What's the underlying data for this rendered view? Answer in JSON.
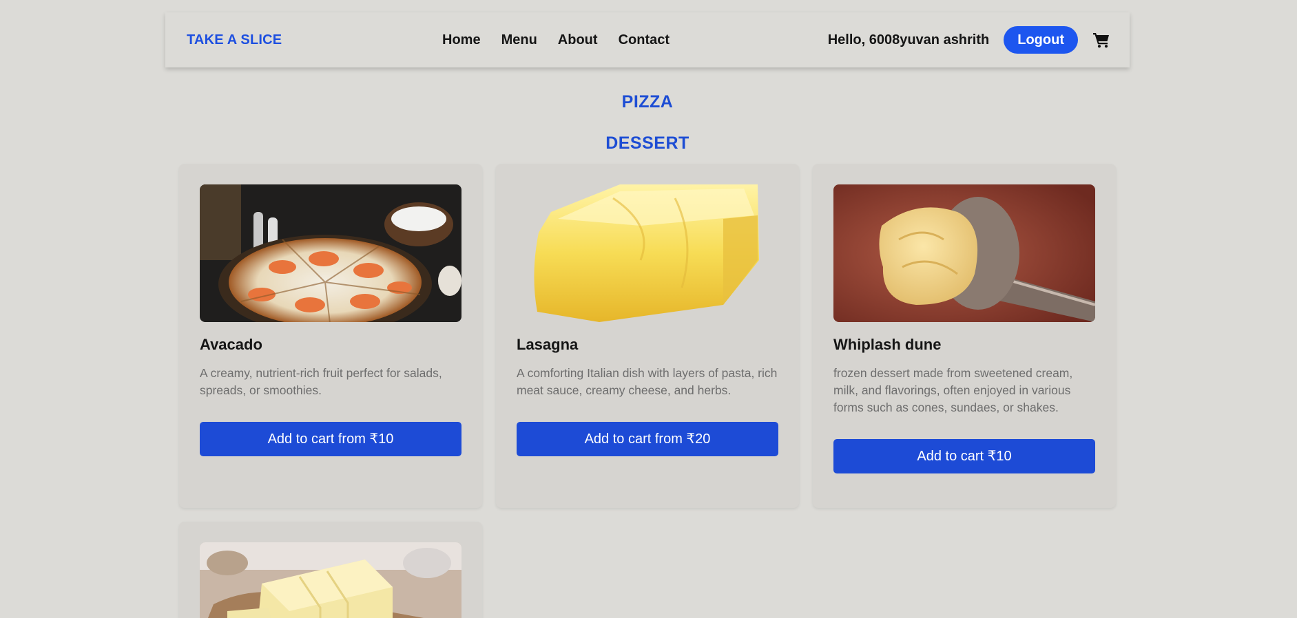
{
  "header": {
    "brand": "TAKE A SLICE",
    "nav": [
      "Home",
      "Menu",
      "About",
      "Contact"
    ],
    "greeting": "Hello, 6008yuvan ashrith",
    "logout_label": "Logout",
    "cart_icon": "cart-icon"
  },
  "categories": [
    "PIZZA",
    "DESSERT"
  ],
  "items": [
    {
      "title": "Avacado",
      "description": "A creamy, nutrient-rich fruit perfect for salads, spreads, or smoothies.",
      "button": "Add to cart from ₹10",
      "image": "pizza-photo"
    },
    {
      "title": "Lasagna",
      "description": "A comforting Italian dish with layers of pasta, rich meat sauce, creamy cheese, and herbs.",
      "button": "Add to cart from ₹20",
      "image": "butter-block-photo"
    },
    {
      "title": "Whiplash dune",
      "description": "frozen dessert made from sweetened cream, milk, and flavorings, often enjoyed in various forms such as cones, sundaes, or shakes.",
      "button": "Add to cart ₹10",
      "image": "ice-cream-scoop-photo"
    },
    {
      "image": "butter-slices-photo"
    }
  ],
  "colors": {
    "background": "#dcdbd7",
    "accent": "#1d4fe0",
    "button": "#1d4bd6",
    "card": "#d6d4d0"
  }
}
